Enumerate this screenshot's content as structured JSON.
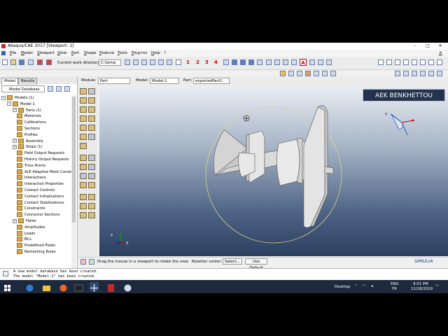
{
  "window": {
    "title": "Abaqus/CAE 2017 [Viewport: 1]",
    "controls": [
      "–",
      "□",
      "✕"
    ]
  },
  "menu": [
    "File",
    "Model",
    "Viewport",
    "View",
    "Part",
    "Shape",
    "Feature",
    "Tools",
    "Plug-ins",
    "Help",
    "?"
  ],
  "toolbar": {
    "workdir_label": "Current work directory:",
    "workdir_value": "C:\\temp",
    "numbers": [
      "1",
      "2",
      "3",
      "4"
    ],
    "text_tool": "A"
  },
  "context": {
    "module_label": "Module:",
    "module_value": "Part",
    "model_label": "Model:",
    "model_value": "Model-1",
    "part_label": "Part:",
    "part_value": "exportedPart2"
  },
  "left_panel": {
    "tabs": [
      "Model",
      "Results"
    ],
    "database": "Model Database",
    "tree": [
      {
        "label": "Models (1)",
        "level": 0,
        "expander": "−"
      },
      {
        "label": "Model-1",
        "level": 1,
        "expander": "−"
      },
      {
        "label": "Parts (1)",
        "level": 2,
        "expander": "+"
      },
      {
        "label": "Materials",
        "level": 2,
        "expander": ""
      },
      {
        "label": "Calibrations",
        "level": 2,
        "expander": ""
      },
      {
        "label": "Sections",
        "level": 2,
        "expander": ""
      },
      {
        "label": "Profiles",
        "level": 2,
        "expander": ""
      },
      {
        "label": "Assembly",
        "level": 2,
        "expander": "+"
      },
      {
        "label": "Steps (1)",
        "level": 2,
        "expander": "+"
      },
      {
        "label": "Field Output Requests",
        "level": 2,
        "expander": ""
      },
      {
        "label": "History Output Requests",
        "level": 2,
        "expander": ""
      },
      {
        "label": "Time Points",
        "level": 2,
        "expander": ""
      },
      {
        "label": "ALE Adaptive Mesh Constr",
        "level": 2,
        "expander": ""
      },
      {
        "label": "Interactions",
        "level": 2,
        "expander": ""
      },
      {
        "label": "Interaction Properties",
        "level": 2,
        "expander": ""
      },
      {
        "label": "Contact Controls",
        "level": 2,
        "expander": ""
      },
      {
        "label": "Contact Initializations",
        "level": 2,
        "expander": ""
      },
      {
        "label": "Contact Stabilizations",
        "level": 2,
        "expander": ""
      },
      {
        "label": "Constraints",
        "level": 2,
        "expander": ""
      },
      {
        "label": "Connector Sections",
        "level": 2,
        "expander": ""
      },
      {
        "label": "Fields",
        "level": 2,
        "expander": "+"
      },
      {
        "label": "Amplitudes",
        "level": 2,
        "expander": ""
      },
      {
        "label": "Loads",
        "level": 2,
        "expander": ""
      },
      {
        "label": "BCs",
        "level": 2,
        "expander": ""
      },
      {
        "label": "Predefined Fields",
        "level": 2,
        "expander": ""
      },
      {
        "label": "Remeshing Rules",
        "level": 2,
        "expander": ""
      }
    ]
  },
  "viewport": {
    "watermark": "AEK BENKHETTOU",
    "brand": "SIMULIA",
    "triad": {
      "x": "X",
      "y": "Y",
      "z": "Z"
    }
  },
  "hint": {
    "prompt": "Drag the mouse in a viewport to rotate the view",
    "rotation_label": "Rotation center:",
    "select_button": "Select...",
    "default_button": "Use Default"
  },
  "messages": [
    "A new model database has been created.",
    "The model \"Model-1\" has been created."
  ],
  "taskbar": {
    "desktop": "Desktop",
    "lang_top": "ENG",
    "lang_bottom": "FR",
    "time": "9:01 PM",
    "date": "12/18/2019"
  },
  "colors": {
    "viewport_top": "#eaeef4",
    "viewport_bottom": "#2b3f60",
    "part_fill": "#e2e2e2",
    "rotation_circle": "#d9d28a",
    "taskbar": "#1d2a3d"
  }
}
